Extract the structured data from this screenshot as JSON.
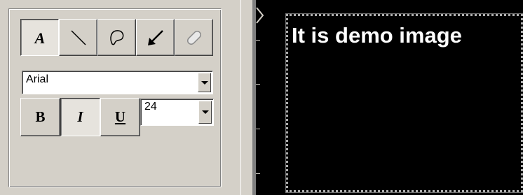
{
  "tools": [
    {
      "name": "text-tool",
      "icon": "text-a-icon",
      "active": true
    },
    {
      "name": "line-tool",
      "icon": "line-icon",
      "active": false
    },
    {
      "name": "lasso-tool",
      "icon": "lasso-icon",
      "active": false
    },
    {
      "name": "arrow-tool",
      "icon": "arrow-icon",
      "active": false
    },
    {
      "name": "eraser-tool",
      "icon": "eraser-icon",
      "active": false
    }
  ],
  "font": {
    "selected": "Arial"
  },
  "size": {
    "selected": "24"
  },
  "format": {
    "bold": "B",
    "italic": "I",
    "underline": "U"
  },
  "canvas": {
    "text": "It is demo image"
  },
  "colors": {
    "accent_arrow": "#000000",
    "canvas_bg": "#000000",
    "text": "#ffffff"
  }
}
